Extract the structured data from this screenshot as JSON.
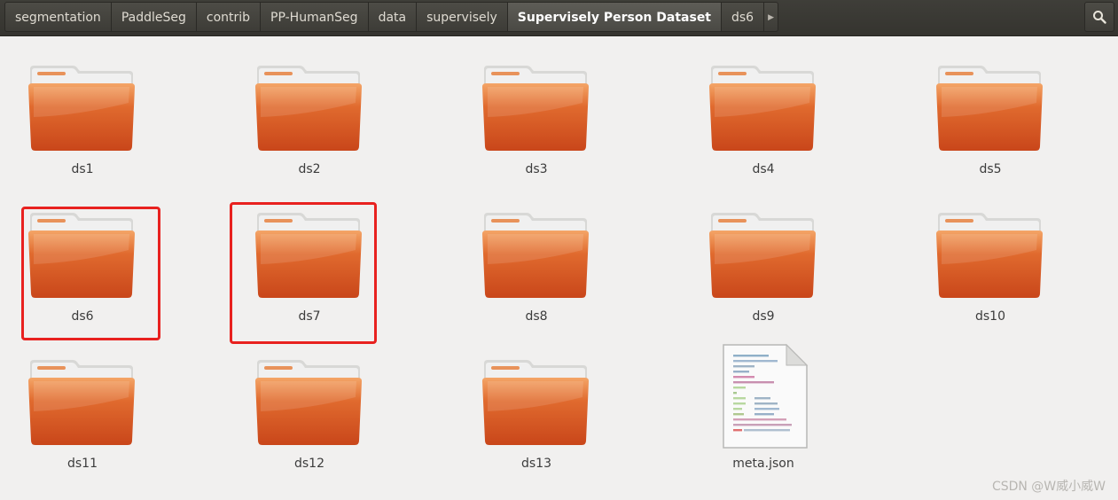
{
  "pathbar": {
    "crumbs": [
      "segmentation",
      "PaddleSeg",
      "contrib",
      "PP-HumanSeg",
      "data",
      "supervisely",
      "Supervisely Person Dataset",
      "ds6"
    ],
    "active_index": 6,
    "more_icon": "chevron-right-icon",
    "search_icon": "search-icon"
  },
  "files": [
    {
      "name": "ds1",
      "type": "folder"
    },
    {
      "name": "ds2",
      "type": "folder"
    },
    {
      "name": "ds3",
      "type": "folder"
    },
    {
      "name": "ds4",
      "type": "folder"
    },
    {
      "name": "ds5",
      "type": "folder"
    },
    {
      "name": "ds6",
      "type": "folder",
      "highlighted": true
    },
    {
      "name": "ds7",
      "type": "folder",
      "highlighted": true
    },
    {
      "name": "ds8",
      "type": "folder"
    },
    {
      "name": "ds9",
      "type": "folder"
    },
    {
      "name": "ds10",
      "type": "folder"
    },
    {
      "name": "ds11",
      "type": "folder"
    },
    {
      "name": "ds12",
      "type": "folder"
    },
    {
      "name": "ds13",
      "type": "folder"
    },
    {
      "name": "meta.json",
      "type": "json-file"
    }
  ],
  "colors": {
    "folder_front": "#e06a2e",
    "folder_front_dark": "#c9461a",
    "folder_back": "#f0f0f0",
    "highlight": "#e8211f"
  },
  "watermark": "CSDN @W威小威W"
}
